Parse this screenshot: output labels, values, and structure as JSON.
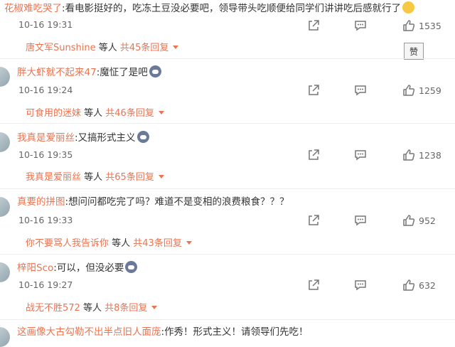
{
  "comments": [
    {
      "username": "花椒难吃哭了",
      "separator": ":",
      "text": "看电影挺好的，吃冻土豆没必要吧，领导带头吃顺便给同学们讲讲吃后感就行了",
      "emoji": "smile-emoji",
      "time": "10-16 19:31",
      "likes": "1535",
      "reply_user": "唐文军Sunshine",
      "reply_mid": " 等人 ",
      "reply_total": "共45条回复"
    },
    {
      "username": "胖大虾就不起来47",
      "separator": ":",
      "text": "魔怔了是吧",
      "emoji": "dog-emoji",
      "time": "10-16 19:24",
      "likes": "1259",
      "reply_user": "可食用的迷妹",
      "reply_mid": " 等人 ",
      "reply_total": "共46条回复"
    },
    {
      "username": "我真是爱丽丝",
      "separator": ":",
      "text": "又搞形式主义",
      "emoji": "dog-emoji",
      "time": "10-16 19:35",
      "likes": "1238",
      "reply_user": "我真是爱丽丝",
      "reply_mid": " 等人 ",
      "reply_total": "共65条回复"
    },
    {
      "username": "真要的拼图",
      "separator": ":",
      "text": "想问问都吃完了吗？难道不是变相的浪费粮食？？？",
      "emoji": "",
      "time": "10-16 19:33",
      "likes": "952",
      "reply_user": "你不要骂人我告诉你",
      "reply_mid": " 等人 ",
      "reply_total": "共43条回复"
    },
    {
      "username": "梓阳Sco",
      "separator": ":",
      "text": "可以，但没必要",
      "emoji": "dog-emoji",
      "time": "10-16 19:27",
      "likes": "632",
      "reply_user": "战无不胜572",
      "reply_mid": " 等人 ",
      "reply_total": "共8条回复"
    },
    {
      "username": "这画像大古勾勒不出半点旧人面庞",
      "separator": ":",
      "text": "作秀！形式主义！请领导们先吃！",
      "emoji": "",
      "time": "",
      "likes": "",
      "reply_user": "",
      "reply_mid": "",
      "reply_total": ""
    }
  ],
  "tooltip": "赞",
  "icons": [
    "share-icon",
    "comment-icon",
    "like-icon"
  ],
  "colors": {
    "username": "#eb7350",
    "text": "#333333",
    "meta": "#666666"
  }
}
